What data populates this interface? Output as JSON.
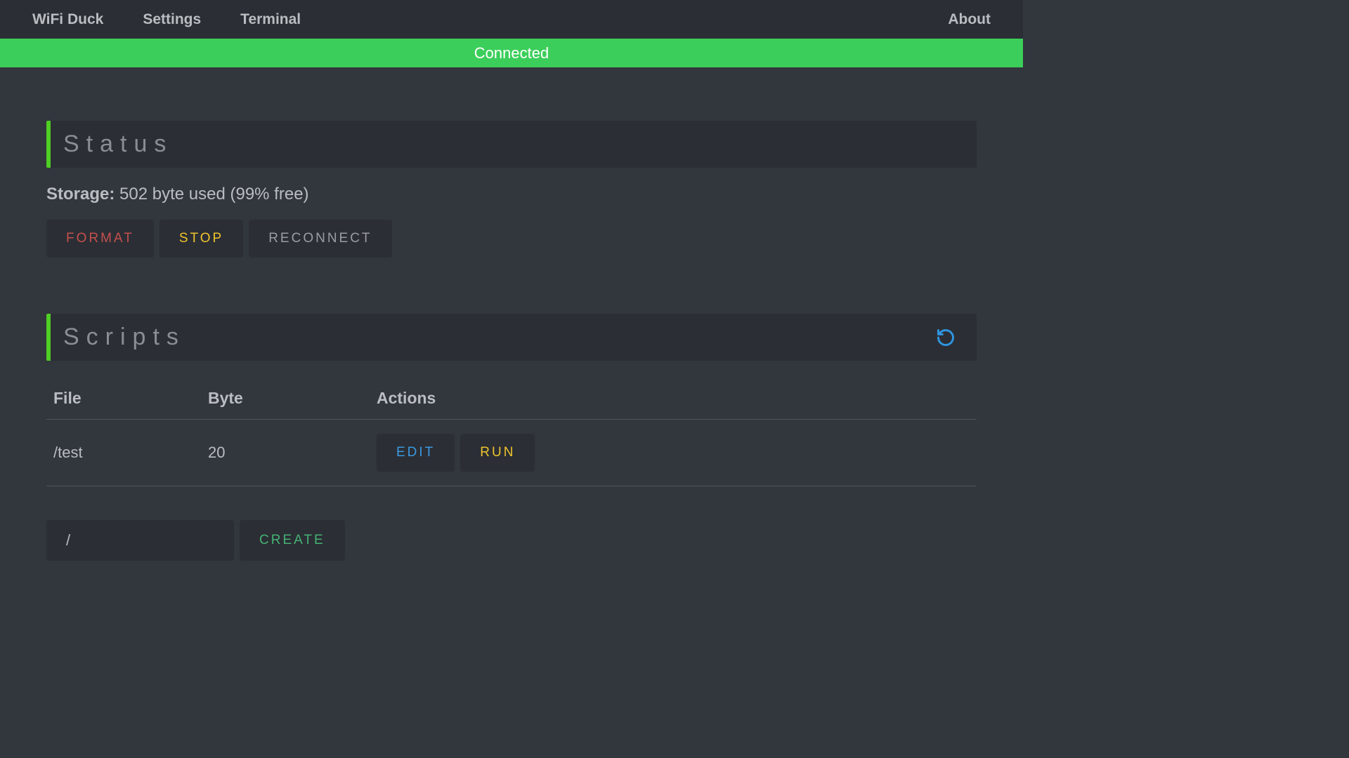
{
  "nav": {
    "items": [
      "WiFi Duck",
      "Settings",
      "Terminal"
    ],
    "about": "About"
  },
  "banner": {
    "text": "Connected"
  },
  "status": {
    "heading": "Status",
    "storage_label": "Storage:",
    "storage_value": "502 byte used (99% free)",
    "buttons": {
      "format": "FORMAT",
      "stop": "STOP",
      "reconnect": "RECONNECT"
    }
  },
  "scripts": {
    "heading": "Scripts",
    "columns": {
      "file": "File",
      "byte": "Byte",
      "actions": "Actions"
    },
    "rows": [
      {
        "file": "/test",
        "byte": "20"
      }
    ],
    "action_labels": {
      "edit": "EDIT",
      "run": "RUN"
    },
    "new_file_value": "/",
    "create_label": "CREATE"
  }
}
